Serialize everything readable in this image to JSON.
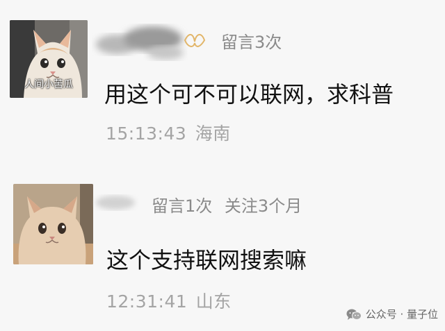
{
  "comments": [
    {
      "avatar_caption": "人间小苦瓜",
      "badges": [
        "留言3次"
      ],
      "content": "用这个可不可以联网，求科普",
      "time": "15:13:43",
      "location": "海南"
    },
    {
      "avatar_caption": "",
      "badges": [
        "留言1次",
        "关注3个月"
      ],
      "content": "这个支持联网搜索嘛",
      "time": "12:31:41",
      "location": "山东"
    }
  ],
  "watermark": {
    "text": "公众号 · 量子位",
    "icon": "wechat-icon"
  }
}
